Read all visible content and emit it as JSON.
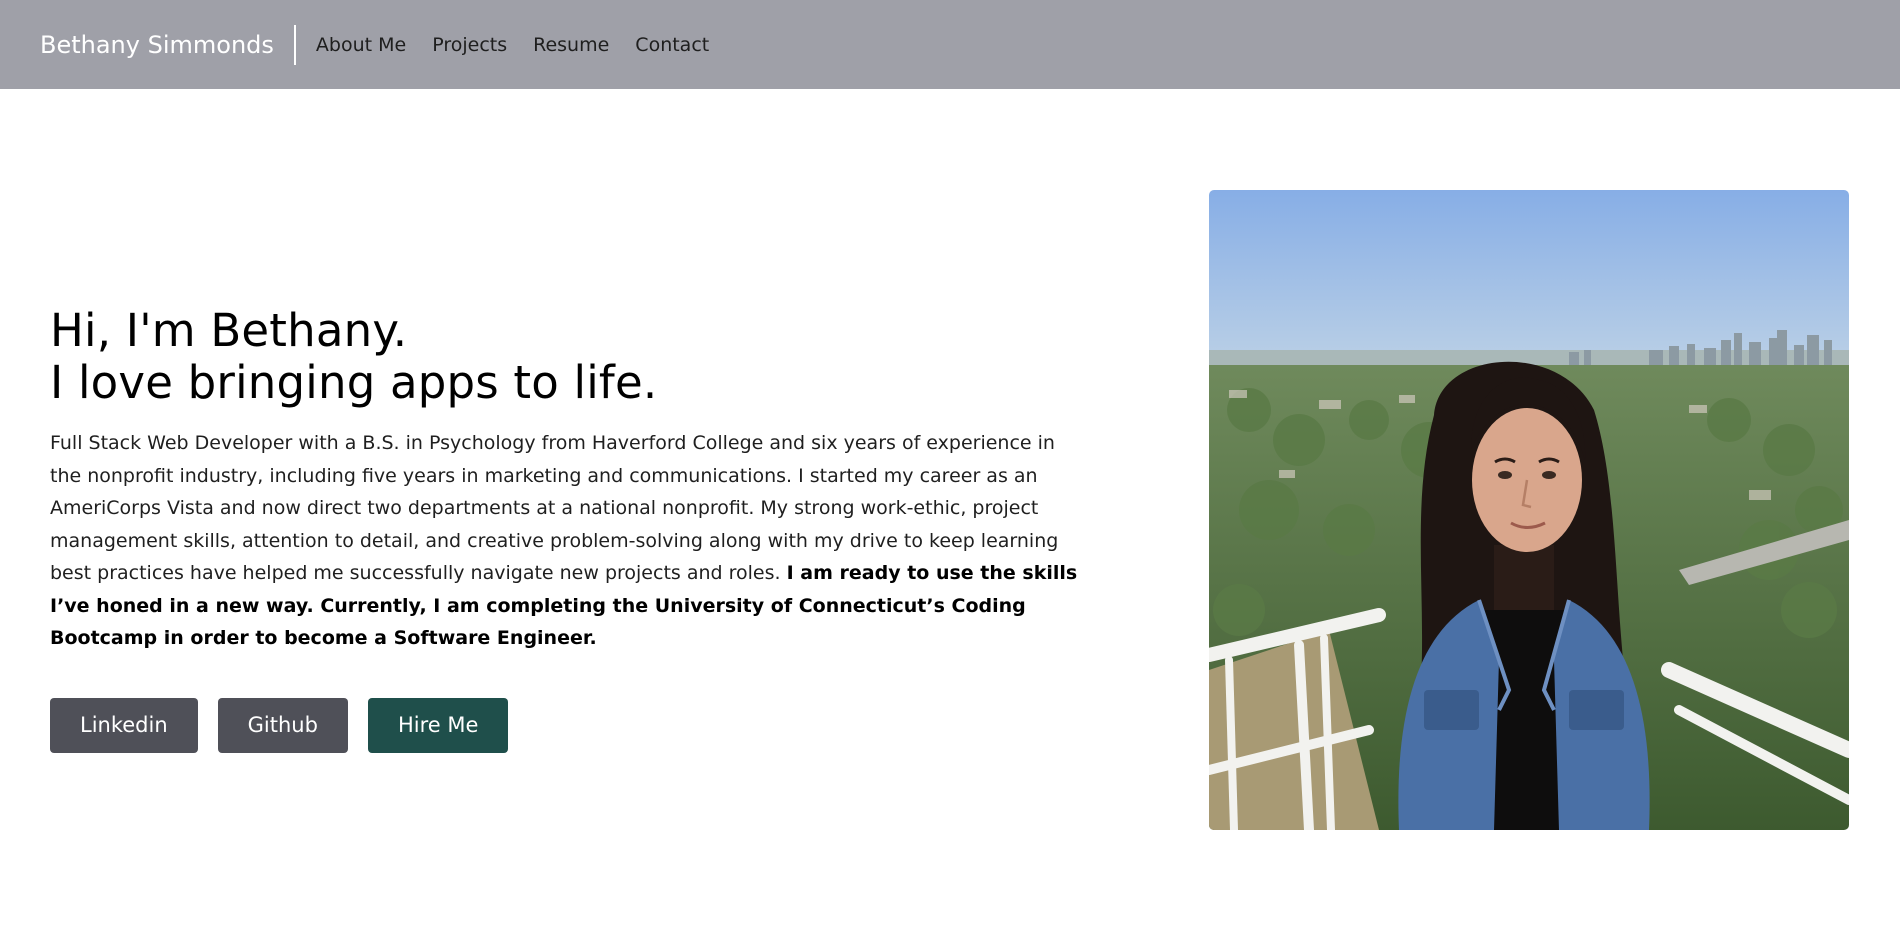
{
  "nav": {
    "brand": "Bethany Simmonds",
    "links": [
      "About Me",
      "Projects",
      "Resume",
      "Contact"
    ]
  },
  "hero": {
    "heading_line1": "Hi, I'm Bethany.",
    "heading_line2": "I love bringing apps to life.",
    "bio_plain": "Full Stack Web Developer with a B.S. in Psychology from Haverford College and six years of experience in the nonprofit industry, including five years in marketing and communications. I started my career as an AmeriCorps Vista and now direct two departments at a national nonprofit. My strong work-ethic, project management skills, attention to detail, and creative problem-solving along with my drive to keep learning best practices have helped me successfully navigate new projects and roles.",
    "bio_bold": "I am ready to use the skills I’ve honed in a new way. Currently, I am completing the University of Connecticut’s Coding Bootcamp in order to become a Software Engineer."
  },
  "buttons": {
    "linkedin": "Linkedin",
    "github": "Github",
    "hire": "Hire Me"
  },
  "colors": {
    "navbar_bg": "#9fa0a8",
    "button_dark": "#4f5058",
    "button_accent": "#1f4f4b"
  }
}
